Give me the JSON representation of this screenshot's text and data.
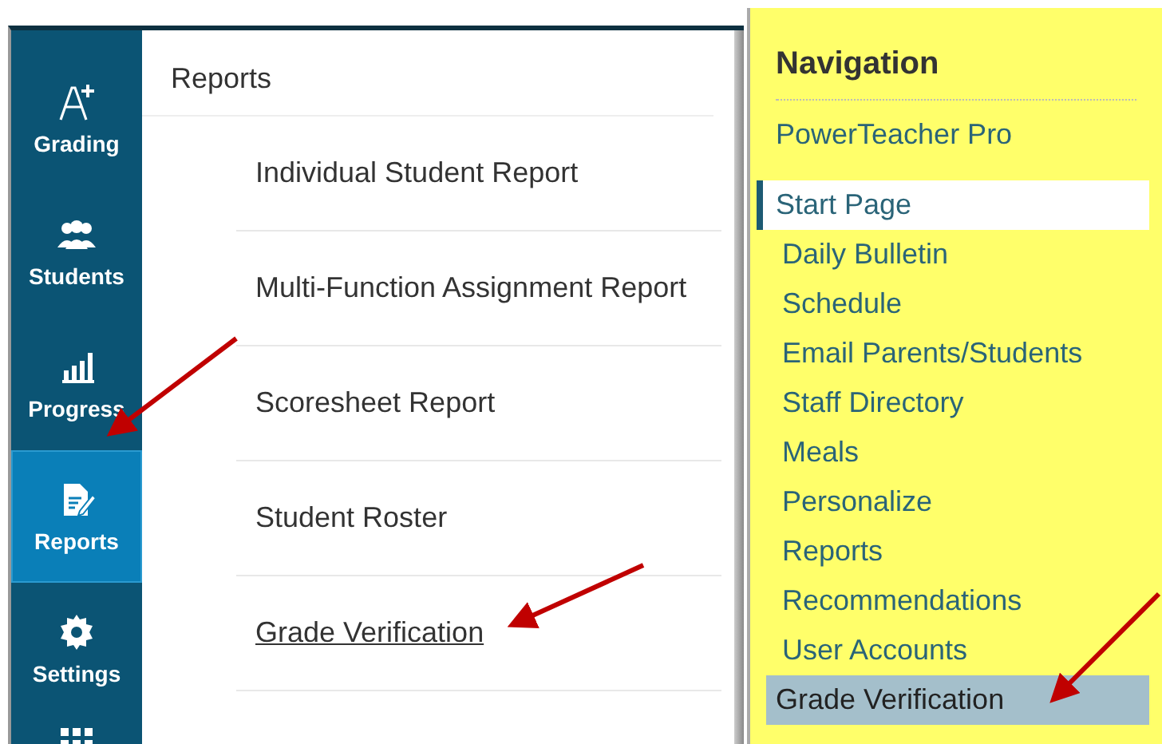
{
  "sidebar": {
    "items": [
      {
        "label": "Grading",
        "kind": "grade",
        "selected": false
      },
      {
        "label": "Students",
        "kind": "people",
        "selected": false
      },
      {
        "label": "Progress",
        "kind": "chart",
        "selected": false
      },
      {
        "label": "Reports",
        "kind": "document",
        "selected": true
      },
      {
        "label": "Settings",
        "kind": "gear",
        "selected": false
      },
      {
        "kind": "apps",
        "selected": false
      }
    ]
  },
  "reports": {
    "title": "Reports",
    "items": [
      {
        "label": "Individual Student Report",
        "underlined": false
      },
      {
        "label": "Multi-Function Assignment Report",
        "underlined": false
      },
      {
        "label": "Scoresheet Report",
        "underlined": false
      },
      {
        "label": "Student Roster",
        "underlined": false
      },
      {
        "label": "Grade Verification",
        "underlined": true
      }
    ]
  },
  "navigation": {
    "title": "Navigation",
    "app_link": "PowerTeacher Pro",
    "items": [
      {
        "label": "Start Page",
        "selected": true,
        "highlighted": false
      },
      {
        "label": "Daily Bulletin",
        "selected": false,
        "highlighted": false
      },
      {
        "label": "Schedule",
        "selected": false,
        "highlighted": false
      },
      {
        "label": "Email Parents/Students",
        "selected": false,
        "highlighted": false
      },
      {
        "label": "Staff Directory",
        "selected": false,
        "highlighted": false
      },
      {
        "label": "Meals",
        "selected": false,
        "highlighted": false
      },
      {
        "label": "Personalize",
        "selected": false,
        "highlighted": false
      },
      {
        "label": "Reports",
        "selected": false,
        "highlighted": false
      },
      {
        "label": "Recommendations",
        "selected": false,
        "highlighted": false
      },
      {
        "label": "User Accounts",
        "selected": false,
        "highlighted": false
      },
      {
        "label": "Grade Verification",
        "selected": false,
        "highlighted": true
      }
    ]
  }
}
